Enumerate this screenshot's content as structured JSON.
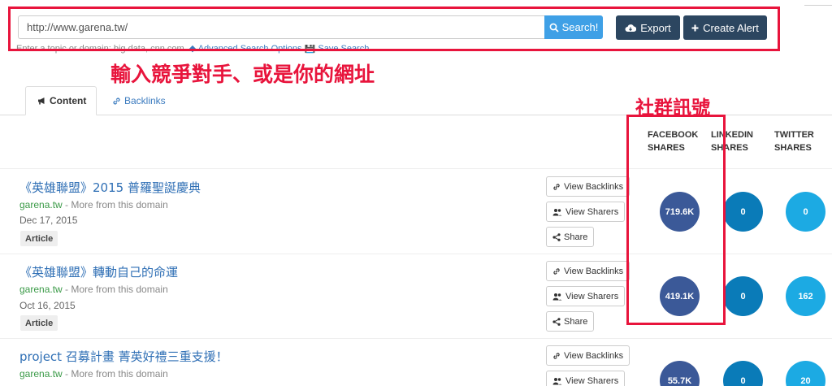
{
  "search": {
    "value": "http://www.garena.tw/",
    "button_label": "Search!",
    "hint_text": "Enter a topic or domain: big data, cnn.com.",
    "advanced_label": "Advanced Search Options",
    "save_label": "Save Search"
  },
  "toolbar": {
    "export_label": "Export",
    "create_alert_label": "Create Alert"
  },
  "annotations": {
    "main_note": "輸入競爭對手、或是你的網址",
    "social_note": "社群訊號"
  },
  "tabs": [
    {
      "label": "Content",
      "active": true
    },
    {
      "label": "Backlinks",
      "active": false
    }
  ],
  "columns": {
    "facebook": [
      "FACEBOOK",
      "SHARES"
    ],
    "linkedin": [
      "LINKEDIN",
      "SHARES"
    ],
    "twitter": [
      "TWITTER",
      "SHARES"
    ]
  },
  "actions": {
    "view_backlinks": "View Backlinks",
    "view_sharers": "View Sharers",
    "share": "Share"
  },
  "results": [
    {
      "title": "《英雄聯盟》2015 普羅聖誕慶典",
      "domain": "garena.tw",
      "more": " - More from this domain",
      "date": "Dec 17, 2015",
      "type": "Article",
      "facebook": "719.6K",
      "linkedin": "0",
      "twitter": "0"
    },
    {
      "title": "《英雄聯盟》轉動自己的命運",
      "domain": "garena.tw",
      "more": " - More from this domain",
      "date": "Oct 16, 2015",
      "type": "Article",
      "facebook": "419.1K",
      "linkedin": "0",
      "twitter": "162"
    },
    {
      "title": "project 召募計畫 菁英好禮三重支援！",
      "domain": "garena.tw",
      "more": " - More from this domain",
      "facebook": "55.7K",
      "linkedin": "0",
      "twitter": "20"
    }
  ],
  "colors": {
    "facebook": "#3b5998",
    "linkedin": "#0a7bb8",
    "twitter": "#1caae3",
    "annotation_red": "#e8143c",
    "search_button": "#3fa0e6",
    "dark_button": "#2c4660"
  }
}
